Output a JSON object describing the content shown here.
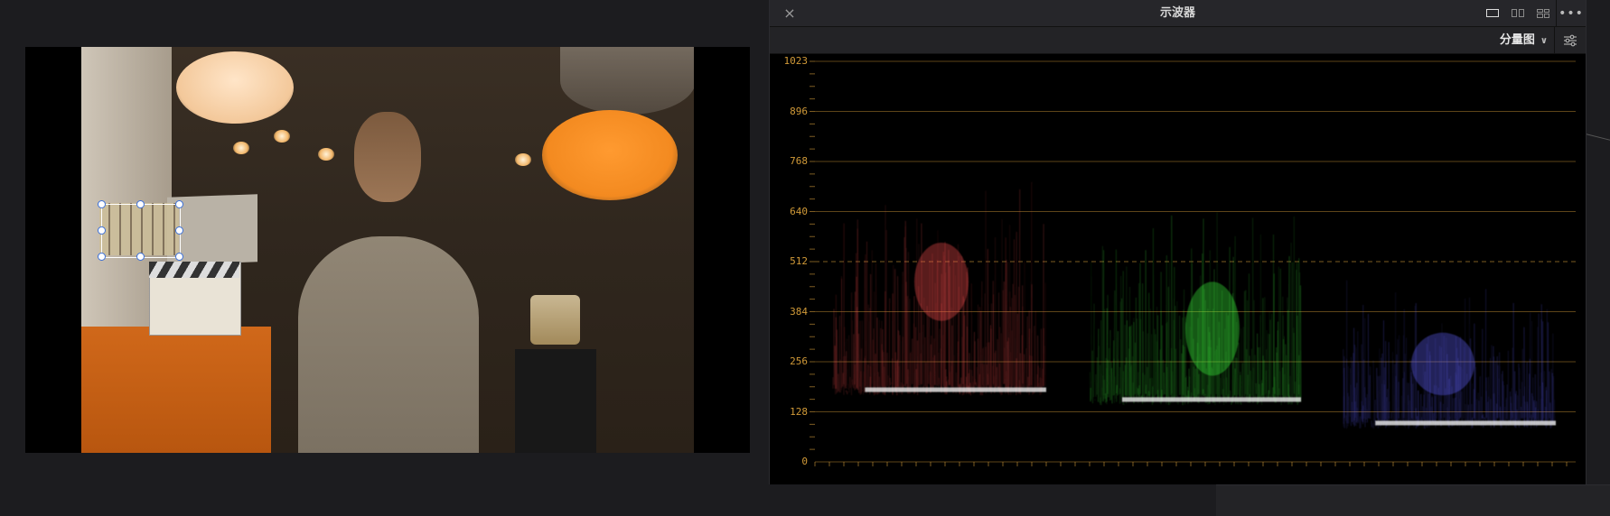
{
  "scope_panel": {
    "title": "示波器",
    "close_label": "×",
    "mode": "分量图",
    "more_label": "•••",
    "y_ticks": [
      "1023",
      "896",
      "768",
      "640",
      "512",
      "384",
      "256",
      "128",
      "0"
    ]
  },
  "colors": {
    "accent": "#d19a38",
    "red_channel": "#ff5050",
    "green_channel": "#40ff40",
    "blue_channel": "#6060ff"
  },
  "icons": {
    "close": "close-icon",
    "layout_single": "layout-single-icon",
    "layout_dual": "layout-dual-icon",
    "layout_quad": "layout-quad-icon",
    "more": "more-icon",
    "settings": "settings-sliders-icon",
    "dropdown": "chevron-down-icon"
  }
}
